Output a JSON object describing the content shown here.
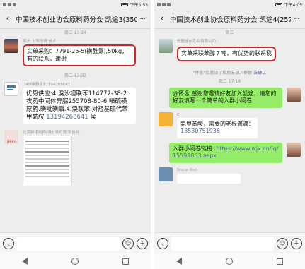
{
  "left": {
    "status": {
      "left": "",
      "right": "下午3:53"
    },
    "title": "中国技术创业协会原料药分会 凯途3(350)",
    "messages": [
      {
        "time": "周二 13:24",
        "sender": "李杰 上海乐研 技术",
        "text": "实单采购：7791-25-5(磺酰氯),50kg，有的联系，谢谢",
        "highlighted": true
      },
      {
        "time": "周二 13:33",
        "sender": "DRD徐静茹13194268641",
        "text": "优势供应:4.溴沙坦联苯114772-38-2.农药中间体异脲255708-80-6.嗪硫磺原药.磺吡磺酯.4.溴联苯.对羟基硫代苯甲酰胺",
        "link": "13194268641",
        "suffix": "侯"
      },
      {
        "sender": "北京颖诺凯药科技 乔月芳 销售经",
        "avatar_label": "JERRY"
      }
    ]
  },
  "right": {
    "status": {
      "left": "",
      "right": "下午4:05"
    },
    "title": "中国技术创业协会原料药分会 凯途4(257)",
    "messages": [
      {
        "time": "周二",
        "sender": "懋磊能州农业有限公司",
        "text": "实单采联苯醇７吨，有优势的联系我",
        "highlighted": true
      },
      {
        "sys": "\"怀念\"您邀请了位朋友加入群聊",
        "sys_link": "去确认"
      },
      {
        "time": "周二 17:14"
      },
      {
        "text": "@怀念  感谢您邀请好友加入凯途，请您的好友填写一个简单的入群小问卷",
        "self": true
      },
      {
        "sender": "C",
        "text": "氨甲苯酸，需要的老板滴滴：",
        "link": "18530751936"
      },
      {
        "text": "入群小问卷链接:",
        "link": "https://www.wjx.cn/jq/15591053.aspx",
        "self": true
      },
      {
        "sender": "Bruce Guo"
      }
    ]
  }
}
